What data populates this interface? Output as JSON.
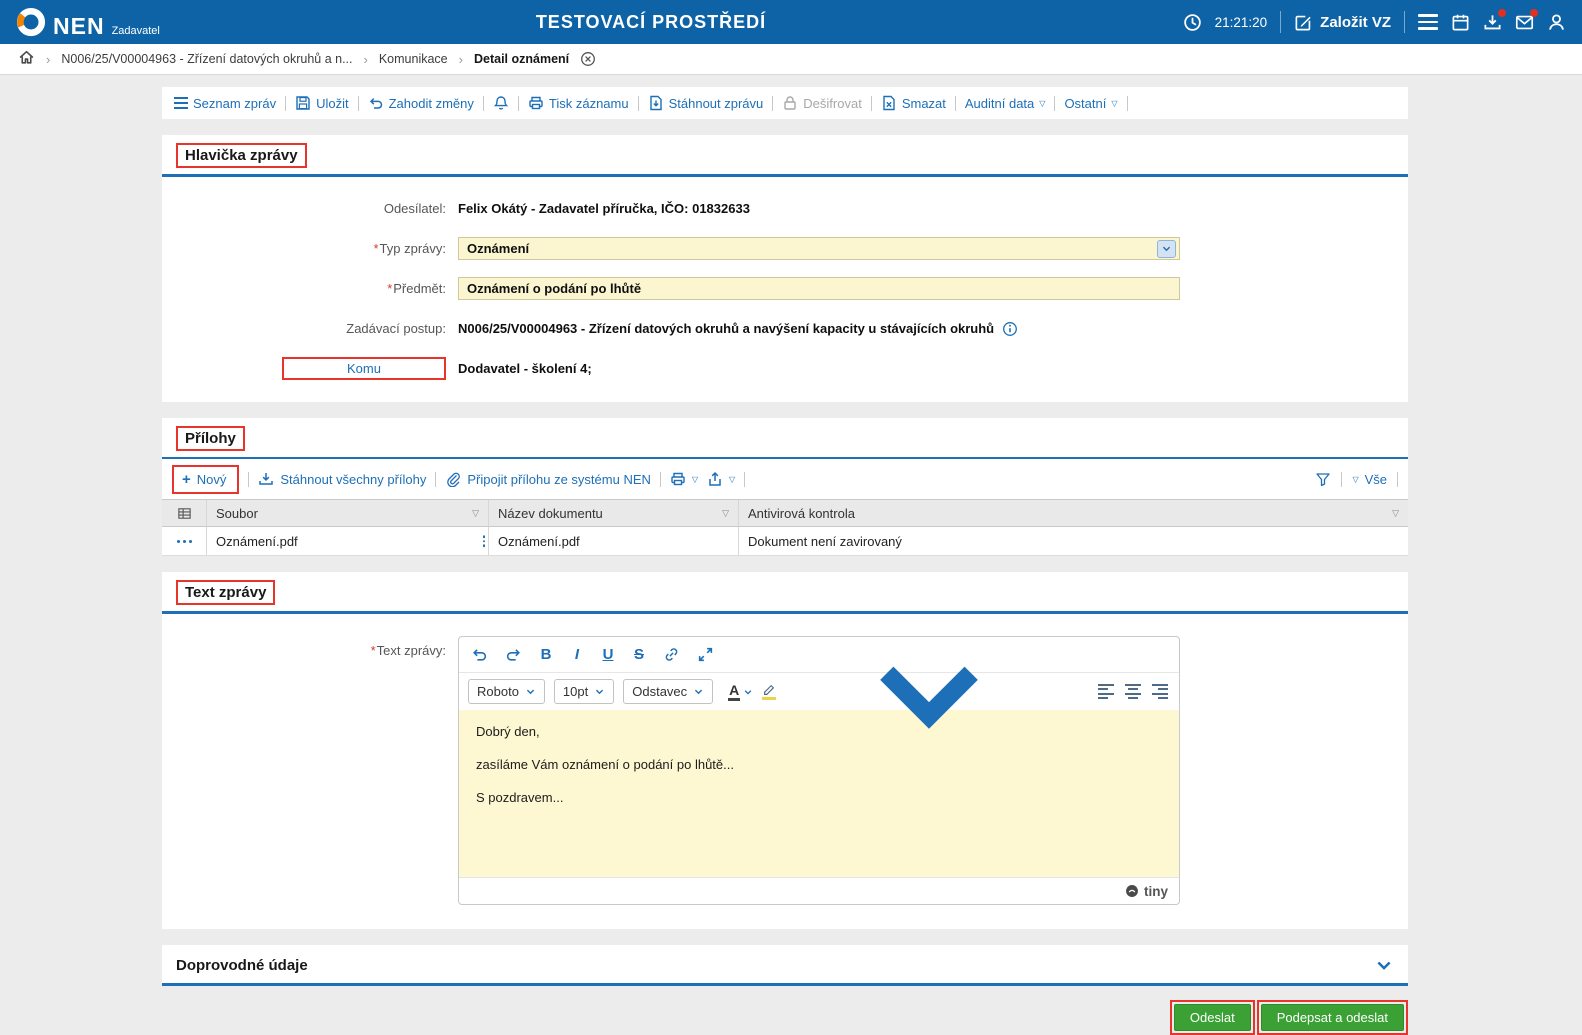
{
  "colors": {
    "header_bg": "#0d63a6",
    "accent_blue": "#1d6fb7",
    "annotation_red": "#e8352b",
    "field_yellow": "#fcf6d0",
    "button_green": "#3ba135"
  },
  "app": {
    "logo": "NEN",
    "logo_sub": "Zadavatel",
    "env_title": "TESTOVACÍ PROSTŘEDÍ",
    "time": "21:21:20",
    "create_vz": "Založit VZ"
  },
  "breadcrumb": {
    "crumb1": "N006/25/V00004963 - Zřízení datových okruhů a n...",
    "crumb2": "Komunikace",
    "crumb3": "Detail oznámení"
  },
  "toolbar": {
    "list": "Seznam zpráv",
    "save": "Uložit",
    "discard": "Zahodit změny",
    "print": "Tisk záznamu",
    "download": "Stáhnout zprávu",
    "decrypt": "Dešifrovat",
    "delete": "Smazat",
    "audit": "Auditní data",
    "other": "Ostatní"
  },
  "common": {
    "required": "*"
  },
  "icons": {
    "crumb_sep": "›",
    "caret": "▽",
    "plus": "+"
  },
  "header_section": {
    "title": "Hlavička zprávy",
    "sender_label": "Odesílatel:",
    "sender_value": "Felix Okátý - Zadavatel příručka, IČO: 01832633",
    "type_label": "Typ zprávy:",
    "type_value": "Oznámení",
    "subject_label": "Předmět:",
    "subject_value": "Oznámení o podání po lhůtě",
    "procedure_label": "Zadávací postup:",
    "procedure_value": "N006/25/V00004963 - Zřízení datových okruhů a navýšení kapacity u stávajících okruhů",
    "to_label": "Komu",
    "to_value": "Dodavatel - školení 4;"
  },
  "attachments": {
    "title": "Přílohy",
    "new_label": "Nový",
    "download_all_label": "Stáhnout všechny přílohy",
    "attach_from_nen_label": "Připojit přílohu ze systému NEN",
    "filter_all_label": "Vše",
    "col_file": "Soubor",
    "col_doc": "Název dokumentu",
    "col_av": "Antivirová kontrola",
    "rows": [
      {
        "file": "Oznámení.pdf",
        "doc": "Oznámení.pdf",
        "av": "Dokument není zavirovaný"
      }
    ]
  },
  "body_section": {
    "title": "Text zprávy",
    "label": "Text zprávy:",
    "editor": {
      "font": "Roboto",
      "size": "10pt",
      "block": "Odstavec",
      "bold": "B",
      "italic": "I",
      "underline": "U",
      "strike": "S",
      "color": "A",
      "para1": "Dobrý den,",
      "para2": "zasíláme Vám oznámení o podání po lhůtě...",
      "para3": "S pozdravem...",
      "brand": "tiny"
    }
  },
  "extra_section": {
    "title": "Doprovodné údaje"
  },
  "actions": {
    "send": "Odeslat",
    "sign_and_send": "Podepsat a odeslat"
  }
}
